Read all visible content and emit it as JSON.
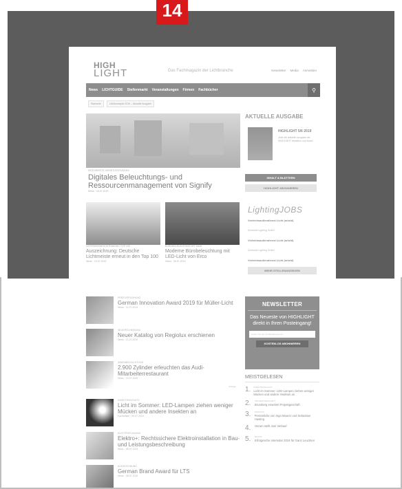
{
  "badge": {
    "number": "14"
  },
  "site": {
    "logo_line1": "HIGH",
    "logo_line2": "LIGHT",
    "tagline": "Das Fachmagazin der Lichtbranche",
    "top_links": [
      "Newsletter",
      "Media",
      "Anmelden"
    ]
  },
  "nav": {
    "items": [
      "News",
      "LICHTGUIDE",
      "Stellenmarkt",
      "Veranstaltungen",
      "Firmen",
      "Fachbücher"
    ],
    "search_icon": "search-icon"
  },
  "breadcrumb": [
    "Startseite",
    "Lichtkonzepte 2019 – Aktuelle Ausgabe"
  ],
  "hero": {
    "category": "INTEGRIERTE DIENSTLEISTUNGEN",
    "title": "Digitales Beleuchtungs- und Ressourcenmanagement von Signify",
    "meta": "News · 16.07.2019"
  },
  "issue": {
    "heading": "AKTUELLE AUSGABE",
    "title": "HIGHLIGHT 5/6 2019",
    "desc": "Jetzt die aktuelle Ausgabe der HIGHLIGHT bestellen und lesen!",
    "btn_read": "INHALT & BLÄTTERN",
    "btn_sub": "HIGHLIGHT ABONNIEREN"
  },
  "cards": [
    {
      "category": "UNTERNEHMEN IM RANKING TOP 100",
      "title": "Auszeichnung: Deutsche Lichtmeiste erneut in den Top 100",
      "meta": "News · 10.07.2019"
    },
    {
      "category": "BÜROBELEUCHTUNG MIT WAW",
      "title": "Moderne Bürobeleuchtung mit LED-Licht von Erco",
      "meta": "Video · 09.07.2019"
    }
  ],
  "jobs": {
    "logo": "LightingJOBS",
    "items": [
      {
        "title": "Vertriebsaußendienst Licht (m/w/d)",
        "company": "Zumtobel Lighting GmbH"
      },
      {
        "title": "Vertriebsaußendienst Licht (m/w/d)",
        "company": "Zumtobel Lighting GmbH"
      },
      {
        "title": "Vertriebsaußendienst Licht (m/w/d)",
        "company": "Zumtobel Lighting GmbH"
      }
    ],
    "more": "MEHR STELLENANZEIGEN"
  },
  "list": [
    {
      "category": "PREISVERLEIHUNG",
      "title": "German Innovation Award 2019 für Müller-Licht",
      "meta": "News · 11.07.2019"
    },
    {
      "category": "NEUERSCHEINUNG",
      "title": "Neuer Katalog von Regiolux erschienen",
      "meta": "News · 11.07.2019"
    },
    {
      "category": "INNENBELEUCHTUNG",
      "title": "2.900 Zylinder erleuchten das Audi-Mitarbeiterrestaurant",
      "meta": "News · 10.07.2019"
    },
    {
      "category": "INSEKTENSCHUTZ",
      "title": "Licht im Sommer: LED-Lampen ziehen weniger Mücken und andere Insekten an",
      "meta": "Fachartikel · 09.07.2019"
    },
    {
      "category": "ELEKTROPLANUNG",
      "title": "Elektro+: Rechtssichere Elektroinstallation in Bau- und Leistungsbeschreibung",
      "meta": "News · 08.07.2019"
    },
    {
      "category": "AUSZEICHNUNG",
      "title": "German Brand Award für LTS",
      "meta": "News · 08.07.2019"
    }
  ],
  "ad_label": "Anzeige",
  "newsletter": {
    "heading": "NEWSLETTER",
    "desc": "Das Neueste von HIGHLIGHT direkt in Ihren Posteingang!",
    "placeholder": "Geben Sie Ihre E-Mail-Adresse ein",
    "button": "KOSTENLOS ABONNIEREN"
  },
  "most_read": {
    "heading": "MEISTGELESEN",
    "items": [
      {
        "num": "1.",
        "cat": "INSEKTENSCHUTZ",
        "title": "Licht im Sommer: LED-Lampen ziehen weniger Mücken und andere Insekten an"
      },
      {
        "num": "2.",
        "cat": "PROJEKTGESCHÄFT",
        "title": "Brumberg erweitert Projektgeschäft"
      },
      {
        "num": "3.",
        "cat": "PODCAST",
        "title": "Persönliche von Ingo Maurer und Sebastian Hasting"
      },
      {
        "num": "4.",
        "cat": "",
        "title": "Osram stellt Juni Verkauf"
      },
      {
        "num": "5.",
        "cat": "BILANZ",
        "title": "Erfolgreiche Intersolar 2019 für Ganz Leuchten"
      }
    ]
  },
  "colors": {
    "overlay": "#5b5b5b",
    "badge": "#d7191c",
    "nav": "#8a8a8a"
  }
}
